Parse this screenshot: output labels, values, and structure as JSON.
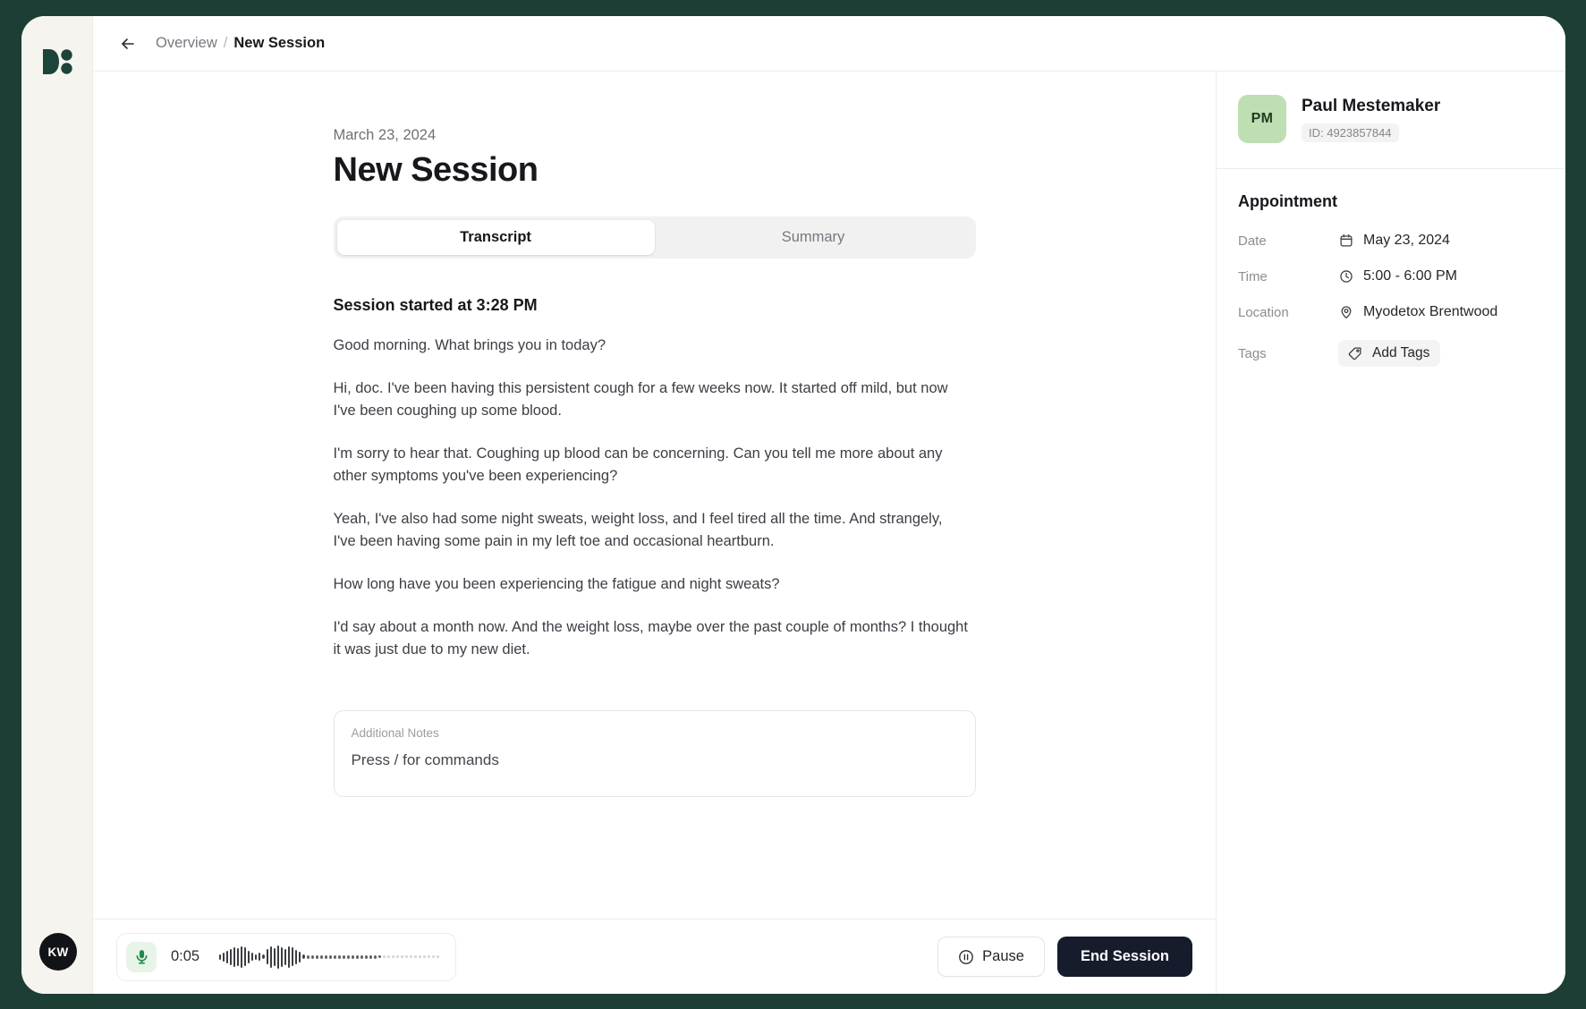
{
  "brand": {
    "logo_icon": "leaf-dots-logo",
    "outer_bg": "#1c3e35",
    "accent_green": "#1f8a4c",
    "dark_button": "#161c2c"
  },
  "rail": {
    "user_avatar_initials": "KW"
  },
  "topbar": {
    "back_icon": "arrow-left-icon",
    "breadcrumb_root": "Overview",
    "breadcrumb_separator": "/",
    "breadcrumb_current": "New Session"
  },
  "main": {
    "date": "March 23, 2024",
    "title": "New Session",
    "tabs": [
      {
        "label": "Transcript",
        "active": true
      },
      {
        "label": "Summary",
        "active": false
      }
    ],
    "transcript_heading": "Session started at 3:28 PM",
    "transcript_lines": [
      "Good morning. What brings you in today?",
      "Hi, doc. I've been having this persistent cough for a few weeks now. It started off mild, but now I've been coughing up some blood.",
      "I'm sorry to hear that. Coughing up blood can be concerning. Can you tell me more about any other symptoms you've been experiencing?",
      "Yeah, I've also had some night sweats, weight loss, and I feel tired all the time. And strangely, I've been having some pain in my left toe and occasional heartburn.",
      "How long have you been experiencing the fatigue and night sweats?",
      "I'd say about a month now. And the weight loss, maybe over the past couple of months? I thought it was just due to my new diet."
    ],
    "notes": {
      "label": "Additional Notes",
      "placeholder": "Press / for commands",
      "value": ""
    }
  },
  "bottombar": {
    "mic_icon": "microphone-icon",
    "elapsed_time": "0:05",
    "waveform_icon": "audio-waveform",
    "pause_icon": "pause-circle-icon",
    "pause_label": "Pause",
    "end_label": "End Session"
  },
  "panel": {
    "patient": {
      "avatar_initials": "PM",
      "name": "Paul Mestemaker",
      "id_label": "ID: 4923857844"
    },
    "appointment_heading": "Appointment",
    "fields": [
      {
        "key": "Date",
        "icon": "calendar-icon",
        "value": "May 23, 2024"
      },
      {
        "key": "Time",
        "icon": "clock-icon",
        "value": "5:00 - 6:00 PM"
      },
      {
        "key": "Location",
        "icon": "map-pin-icon",
        "value": "Myodetox Brentwood"
      }
    ],
    "tags": {
      "key": "Tags",
      "icon": "tag-icon",
      "add_label": "Add Tags"
    }
  }
}
